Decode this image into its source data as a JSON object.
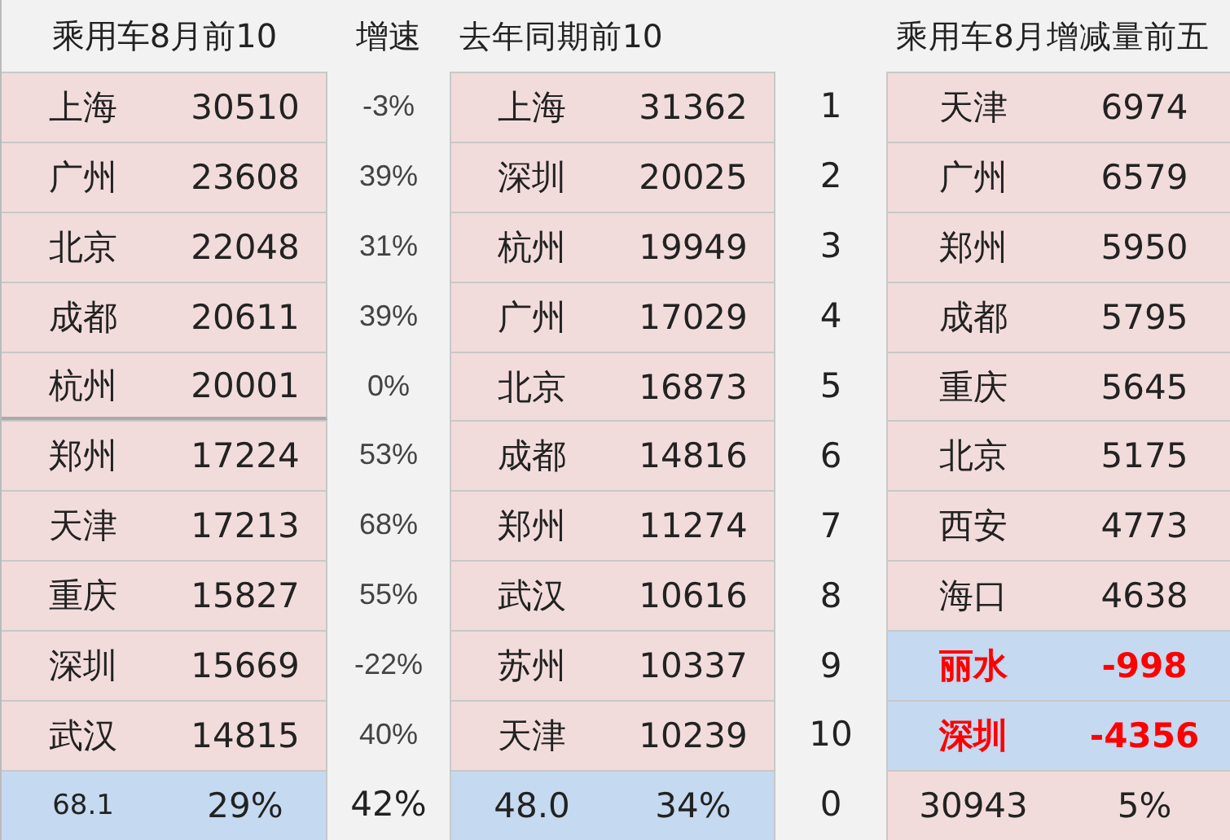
{
  "headers": {
    "top10": "乘用车8月前10",
    "growth": "增速",
    "last_year": "去年同期前10",
    "change": "乘用车8月增减量前五"
  },
  "rows": [
    {
      "city": "上海",
      "sales": "30510",
      "growth": "-3%",
      "ly_city": "上海",
      "ly_sales": "31362",
      "rank": "1",
      "change_city": "天津",
      "change": "6974",
      "highlighted": false
    },
    {
      "city": "广州",
      "sales": "23608",
      "growth": "39%",
      "ly_city": "深圳",
      "ly_sales": "20025",
      "rank": "2",
      "change_city": "广州",
      "change": "6579",
      "highlighted": false
    },
    {
      "city": "北京",
      "sales": "22048",
      "growth": "31%",
      "ly_city": "杭州",
      "ly_sales": "19949",
      "rank": "3",
      "change_city": "郑州",
      "change": "5950",
      "highlighted": false
    },
    {
      "city": "成都",
      "sales": "20611",
      "growth": "39%",
      "ly_city": "广州",
      "ly_sales": "17029",
      "rank": "4",
      "change_city": "成都",
      "change": "5795",
      "highlighted": false
    },
    {
      "city": "杭州",
      "sales": "20001",
      "growth": "0%",
      "ly_city": "北京",
      "ly_sales": "16873",
      "rank": "5",
      "change_city": "重庆",
      "change": "5645",
      "highlighted": false
    },
    {
      "city": "郑州",
      "sales": "17224",
      "growth": "53%",
      "ly_city": "成都",
      "ly_sales": "14816",
      "rank": "6",
      "change_city": "北京",
      "change": "5175",
      "highlighted": false
    },
    {
      "city": "天津",
      "sales": "17213",
      "growth": "68%",
      "ly_city": "郑州",
      "ly_sales": "11274",
      "rank": "7",
      "change_city": "西安",
      "change": "4773",
      "highlighted": false
    },
    {
      "city": "重庆",
      "sales": "15827",
      "growth": "55%",
      "ly_city": "武汉",
      "ly_sales": "10616",
      "rank": "8",
      "change_city": "海口",
      "change": "4638",
      "highlighted": false
    },
    {
      "city": "深圳",
      "sales": "15669",
      "growth": "-22%",
      "ly_city": "苏州",
      "ly_sales": "10337",
      "rank": "9",
      "change_city": "丽水",
      "change": "-998",
      "highlighted": true
    },
    {
      "city": "武汉",
      "sales": "14815",
      "growth": "40%",
      "ly_city": "天津",
      "ly_sales": "10239",
      "rank": "10",
      "change_city": "深圳",
      "change": "-4356",
      "highlighted": true
    }
  ],
  "totals": {
    "share": "68.1",
    "growth": "29%",
    "overall_growth": "42%",
    "ly_share": "48.0",
    "ly_growth": "34%",
    "rank": "0",
    "change_total": "30943",
    "change_growth": "5%"
  }
}
